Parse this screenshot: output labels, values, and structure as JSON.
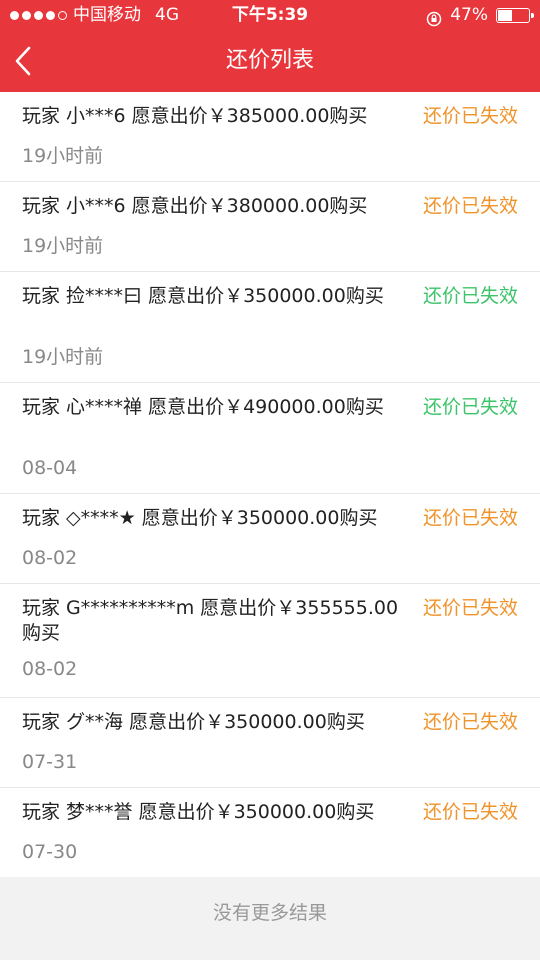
{
  "status_bar": {
    "carrier": "中国移动",
    "network": "4G",
    "time": "下午5:39",
    "battery": "47%",
    "battery_level": 0.47
  },
  "nav": {
    "title": "还价列表",
    "back_icon": "chevron-left-icon"
  },
  "colors": {
    "header": "#e8373c",
    "orange": "#f0932b",
    "green": "#3cc46a"
  },
  "items": [
    {
      "text": "玩家 小***6 愿意出价￥385000.00购买",
      "time": "19小时前",
      "status": "还价已失效",
      "status_color": "orange"
    },
    {
      "text": "玩家 小***6 愿意出价￥380000.00购买",
      "time": "19小时前",
      "status": "还价已失效",
      "status_color": "orange"
    },
    {
      "text": "玩家 捡****曰 愿意出价￥350000.00购买",
      "time": "19小时前",
      "status": "还价已失效",
      "status_color": "green"
    },
    {
      "text": "玩家 心****禅 愿意出价￥490000.00购买",
      "time": "08-04",
      "status": "还价已失效",
      "status_color": "green"
    },
    {
      "text": "玩家 ◇****★ 愿意出价￥350000.00购买",
      "time": "08-02",
      "status": "还价已失效",
      "status_color": "orange"
    },
    {
      "text": "玩家 G**********m 愿意出价￥355555.00购买",
      "time": "08-02",
      "status": "还价已失效",
      "status_color": "orange"
    },
    {
      "text": "玩家 グ**海 愿意出价￥350000.00购买",
      "time": "07-31",
      "status": "还价已失效",
      "status_color": "orange"
    },
    {
      "text": "玩家 梦***誉 愿意出价￥350000.00购买",
      "time": "07-30",
      "status": "还价已失效",
      "status_color": "orange"
    }
  ],
  "footer": {
    "text": "没有更多结果"
  }
}
